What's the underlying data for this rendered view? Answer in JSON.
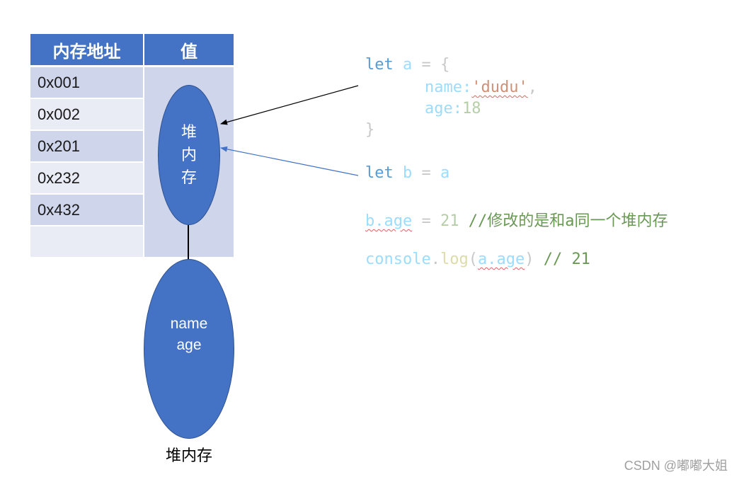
{
  "table": {
    "headers": [
      "内存地址",
      "值"
    ],
    "addresses": [
      "0x001",
      "0x002",
      "0x201",
      "0x232",
      "0x432",
      ""
    ],
    "value_cell_label": "堆\n内\n存"
  },
  "heap_object": {
    "fields": [
      "name",
      "age"
    ],
    "caption": "堆内存"
  },
  "code": {
    "line1": {
      "kw": "let",
      "var": "a",
      "op": "=",
      "brace": "{"
    },
    "line2": {
      "key": "name:",
      "str": "'dudu'",
      "comma": ","
    },
    "line3": {
      "key": "age:",
      "num": "18"
    },
    "line4": {
      "brace": "}"
    },
    "line5": {
      "kw": "let",
      "var": "b",
      "op": "=",
      "val": "a"
    },
    "line6": {
      "lhs": "b.age",
      "op": "=",
      "num": "21",
      "comment": "//修改的是和a同一个堆内存"
    },
    "line7": {
      "obj": "console",
      "dot": ".",
      "fn": "log",
      "open": "(",
      "arg": "a.age",
      "close": ")",
      "comment": "// 21"
    }
  },
  "watermark": "CSDN @嘟嘟大姐",
  "colors": {
    "header_blue": "#4472c4",
    "row_dark": "#cfd5ea",
    "row_light": "#e9ebf5",
    "ellipse_fill": "#4472c4"
  }
}
